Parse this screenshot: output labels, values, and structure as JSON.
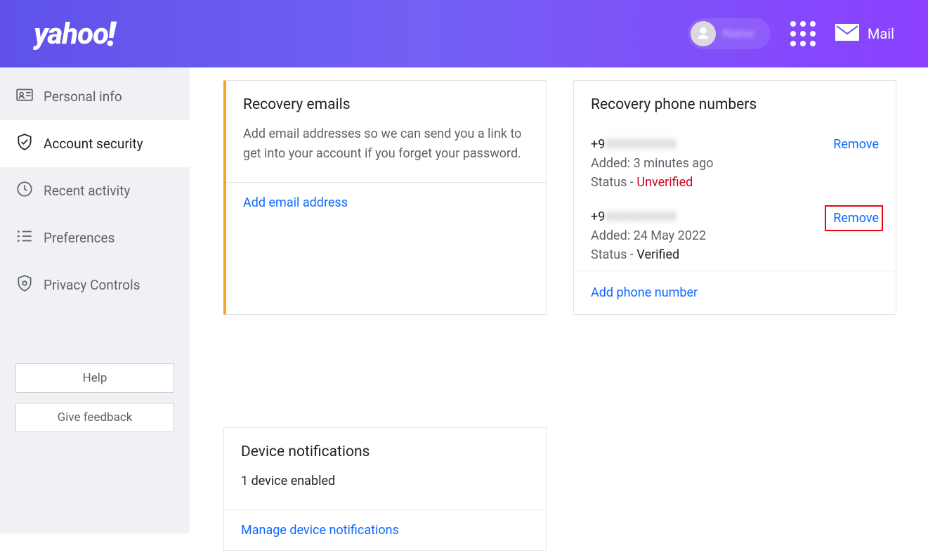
{
  "header": {
    "logo_text": "yahoo",
    "logo_excl": "!",
    "user_name": "Name",
    "mail_label": "Mail"
  },
  "sidebar": {
    "items": [
      {
        "label": "Personal info"
      },
      {
        "label": "Account security"
      },
      {
        "label": "Recent activity"
      },
      {
        "label": "Preferences"
      },
      {
        "label": "Privacy Controls"
      }
    ],
    "help_label": "Help",
    "feedback_label": "Give feedback"
  },
  "recovery_emails": {
    "title": "Recovery emails",
    "desc": "Add email addresses so we can send you a link to get into your account if you forget your password.",
    "add_label": "Add email address"
  },
  "recovery_phones": {
    "title": "Recovery phone numbers",
    "items": [
      {
        "prefix": "+9",
        "masked": "XXXXXXXXX",
        "added_label": "Added:",
        "added_value": "3 minutes ago",
        "status_label": "Status -",
        "status_value": "Unverified",
        "status_kind": "bad",
        "remove_label": "Remove"
      },
      {
        "prefix": "+9",
        "masked": "XXXXXXXXX",
        "added_label": "Added:",
        "added_value": "24 May 2022",
        "status_label": "Status -",
        "status_value": "Verified",
        "status_kind": "ok",
        "remove_label": "Remove"
      }
    ],
    "add_label": "Add phone number"
  },
  "device_notifications": {
    "title": "Device notifications",
    "subtitle": "1 device enabled",
    "manage_label": "Manage device notifications"
  }
}
